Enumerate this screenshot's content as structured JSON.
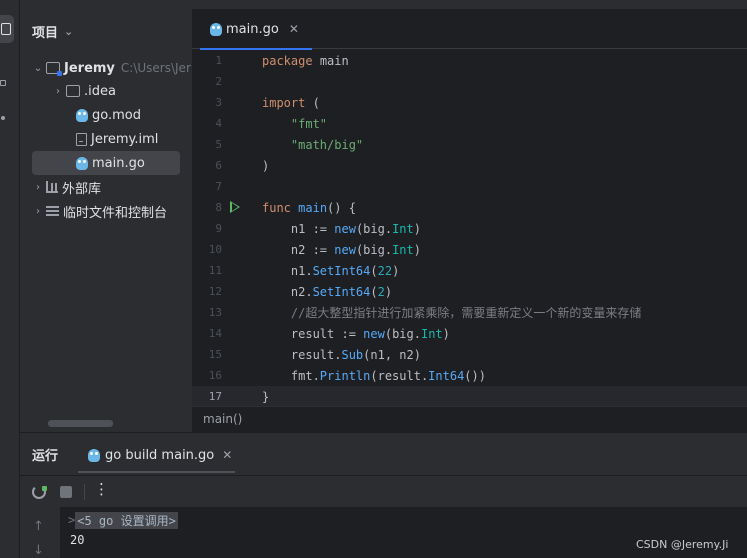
{
  "project_panel": {
    "title": "项目",
    "tree": [
      {
        "label": "Jeremy",
        "extra": "C:\\Users\\Jer",
        "arrow": "⌄",
        "icon": "folder-module-icon"
      },
      {
        "label": ".idea",
        "arrow": "›",
        "icon": "folder-icon"
      },
      {
        "label": "go.mod",
        "icon": "go-mod-icon"
      },
      {
        "label": "Jeremy.iml",
        "icon": "iml-file-icon"
      },
      {
        "label": "main.go",
        "icon": "go-file-icon"
      },
      {
        "label": "外部库",
        "arrow": "›",
        "icon": "library-icon"
      },
      {
        "label": "临时文件和控制台",
        "arrow": "›",
        "icon": "scratch-icon"
      }
    ]
  },
  "editor": {
    "tab_label": "main.go",
    "breadcrumb": "main()",
    "line_numbers": [
      "1",
      "2",
      "3",
      "4",
      "5",
      "6",
      "7",
      "8",
      "9",
      "10",
      "11",
      "12",
      "13",
      "14",
      "15",
      "16",
      "17"
    ]
  },
  "run_panel": {
    "title": "运行",
    "tab_label": "go build main.go",
    "output_command": "<5 go 设置调用>",
    "output_prompt": ">",
    "output_result": "20"
  },
  "watermark": "CSDN @Jeremy.Ji",
  "colors": {
    "background": "#1e1f22",
    "panel": "#2b2d30",
    "accent": "#3574f0",
    "keyword": "#cf8e6d",
    "string": "#6aab73",
    "number": "#2aacb8",
    "run_green": "#5fb865"
  }
}
